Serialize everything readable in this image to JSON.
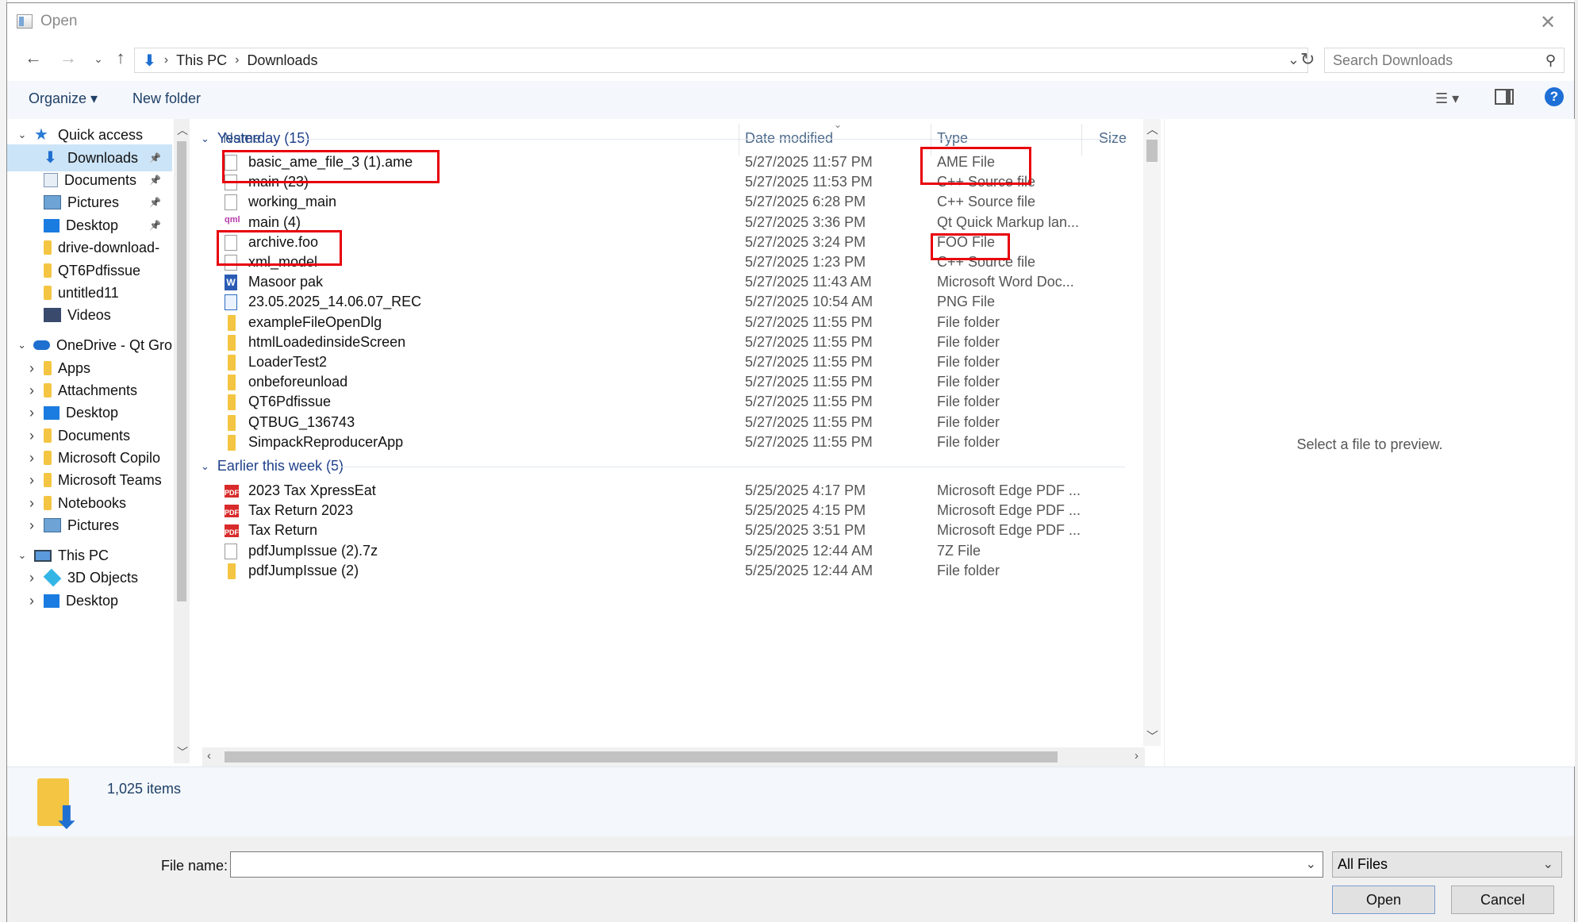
{
  "window": {
    "title": "Open"
  },
  "address": {
    "crumbs": [
      "This PC",
      "Downloads"
    ],
    "search_placeholder": "Search Downloads"
  },
  "toolbar": {
    "organize": "Organize ▾",
    "new_folder": "New folder"
  },
  "nav": [
    {
      "label": "Quick access",
      "icon": "star-icon"
    },
    {
      "label": "Downloads",
      "icon": "download-icon",
      "pinned": true,
      "selected": true
    },
    {
      "label": "Documents",
      "icon": "documents-icon",
      "pinned": true
    },
    {
      "label": "Pictures",
      "icon": "pictures-icon",
      "pinned": true
    },
    {
      "label": "Desktop",
      "icon": "desktop-icon",
      "pinned": true
    },
    {
      "label": "drive-download-",
      "icon": "folder-icon"
    },
    {
      "label": "QT6Pdfissue",
      "icon": "folder-icon"
    },
    {
      "label": "untitled11",
      "icon": "folder-icon"
    },
    {
      "label": "Videos",
      "icon": "videos-icon"
    },
    {
      "label": "OneDrive - Qt Gro",
      "icon": "onedrive-icon"
    },
    {
      "label": "Apps",
      "icon": "folder-icon"
    },
    {
      "label": "Attachments",
      "icon": "folder-icon"
    },
    {
      "label": "Desktop",
      "icon": "desktop-icon"
    },
    {
      "label": "Documents",
      "icon": "folder-icon"
    },
    {
      "label": "Microsoft Copilo",
      "icon": "folder-icon"
    },
    {
      "label": "Microsoft Teams",
      "icon": "folder-icon"
    },
    {
      "label": "Notebooks",
      "icon": "folder-icon"
    },
    {
      "label": "Pictures",
      "icon": "pictures-icon"
    },
    {
      "label": "This PC",
      "icon": "this-pc-icon"
    },
    {
      "label": "3D Objects",
      "icon": "3d-objects-icon"
    },
    {
      "label": "Desktop",
      "icon": "desktop-icon"
    }
  ],
  "columns": {
    "name": "Name",
    "date": "Date modified",
    "type": "Type",
    "size": "Size"
  },
  "groups": [
    {
      "label": "Yesterday (15)",
      "files": [
        {
          "name": "basic_ame_file_3 (1).ame",
          "date": "5/27/2025 11:57 PM",
          "type": "AME File",
          "icon": "file"
        },
        {
          "name": "main (23)",
          "date": "5/27/2025 11:53 PM",
          "type": "C++ Source file",
          "icon": "file"
        },
        {
          "name": "working_main",
          "date": "5/27/2025 6:28 PM",
          "type": "C++ Source file",
          "icon": "file"
        },
        {
          "name": "main (4)",
          "date": "5/27/2025 3:36 PM",
          "type": "Qt Quick Markup lan...",
          "icon": "qml"
        },
        {
          "name": "archive.foo",
          "date": "5/27/2025 3:24 PM",
          "type": "FOO File",
          "icon": "file"
        },
        {
          "name": "xml_model",
          "date": "5/27/2025 1:23 PM",
          "type": "C++ Source file",
          "icon": "file"
        },
        {
          "name": "Masoor pak",
          "date": "5/27/2025 11:43 AM",
          "type": "Microsoft Word Doc...",
          "icon": "word"
        },
        {
          "name": "23.05.2025_14.06.07_REC",
          "date": "5/27/2025 10:54 AM",
          "type": "PNG File",
          "icon": "png"
        },
        {
          "name": "exampleFileOpenDlg",
          "date": "5/27/2025 11:55 PM",
          "type": "File folder",
          "icon": "folder"
        },
        {
          "name": "htmlLoadedinsideScreen",
          "date": "5/27/2025 11:55 PM",
          "type": "File folder",
          "icon": "folder"
        },
        {
          "name": "LoaderTest2",
          "date": "5/27/2025 11:55 PM",
          "type": "File folder",
          "icon": "folder"
        },
        {
          "name": "onbeforeunload",
          "date": "5/27/2025 11:55 PM",
          "type": "File folder",
          "icon": "folder"
        },
        {
          "name": "QT6Pdfissue",
          "date": "5/27/2025 11:55 PM",
          "type": "File folder",
          "icon": "folder"
        },
        {
          "name": "QTBUG_136743",
          "date": "5/27/2025 11:55 PM",
          "type": "File folder",
          "icon": "folder"
        },
        {
          "name": "SimpackReproducerApp",
          "date": "5/27/2025 11:55 PM",
          "type": "File folder",
          "icon": "folder"
        }
      ]
    },
    {
      "label": "Earlier this week (5)",
      "files": [
        {
          "name": "2023 Tax XpressEat",
          "date": "5/25/2025 4:17 PM",
          "type": "Microsoft Edge PDF ...",
          "icon": "pdf"
        },
        {
          "name": "Tax Return 2023",
          "date": "5/25/2025 4:15 PM",
          "type": "Microsoft Edge PDF ...",
          "icon": "pdf"
        },
        {
          "name": "Tax Return",
          "date": "5/25/2025 3:51 PM",
          "type": "Microsoft Edge PDF ...",
          "icon": "pdf"
        },
        {
          "name": "pdfJumpIssue (2).7z",
          "date": "5/25/2025 12:44 AM",
          "type": "7Z File",
          "icon": "file"
        },
        {
          "name": "pdfJumpIssue (2)",
          "date": "5/25/2025 12:44 AM",
          "type": "File folder",
          "icon": "folder"
        }
      ]
    }
  ],
  "preview": {
    "message": "Select a file to preview."
  },
  "details": {
    "item_count": "1,025 items"
  },
  "bottom": {
    "file_name_label": "File name:",
    "file_name_value": "",
    "filter": "All Files",
    "open": "Open",
    "cancel": "Cancel"
  },
  "colors": {
    "highlight": "#e8000b",
    "selection": "#cce4f7",
    "accent": "#1d6fd6"
  }
}
